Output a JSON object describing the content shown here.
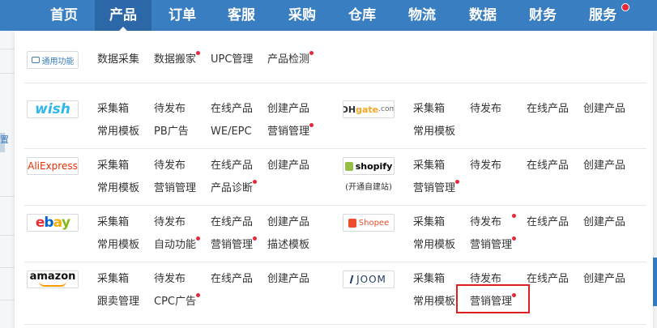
{
  "nav": {
    "items": [
      "首页",
      "产品",
      "订单",
      "客服",
      "采购",
      "仓库",
      "物流",
      "数据",
      "财务",
      "服务"
    ],
    "active": "产品"
  },
  "general": {
    "badge": "通用功能",
    "links": [
      "数据采集",
      "数据搬家",
      "UPC管理",
      "产品检测"
    ]
  },
  "platforms": {
    "wish": {
      "logo": "wish",
      "row1": [
        "采集箱",
        "待发布",
        "在线产品",
        "创建产品"
      ],
      "row2": [
        "常用模板",
        "PB广告",
        "WE/EPC",
        "营销管理"
      ]
    },
    "dhgate": {
      "logo_a": "DH",
      "logo_b": "gate",
      "logo_c": ".com",
      "row1": [
        "采集箱",
        "待发布",
        "在线产品",
        "创建产品"
      ],
      "row2": [
        "常用模板"
      ]
    },
    "aliexpress": {
      "logo": "AliExpress",
      "row1": [
        "采集箱",
        "待发布",
        "在线产品",
        "创建产品"
      ],
      "row2": [
        "常用模板",
        "营销管理",
        "产品诊断"
      ]
    },
    "shopify": {
      "logo": "shopify",
      "sub": "(开通自建站)",
      "row1": [
        "采集箱",
        "待发布",
        "在线产品",
        "创建产品"
      ],
      "row2": [
        "营销管理"
      ]
    },
    "ebay": {
      "logo_letters": [
        "e",
        "b",
        "a",
        "y"
      ],
      "row1": [
        "采集箱",
        "待发布",
        "在线产品",
        "创建产品"
      ],
      "row2": [
        "常用模板",
        "自动功能",
        "营销管理",
        "描述模板"
      ]
    },
    "shopee": {
      "logo": "Shopee",
      "row1": [
        "采集箱",
        "待发布",
        "在线产品",
        "创建产品"
      ],
      "row2": [
        "常用模板",
        "营销管理"
      ]
    },
    "amazon": {
      "logo": "amazon",
      "row1": [
        "采集箱",
        "待发布",
        "在线产品",
        "创建产品"
      ],
      "row2": [
        "跟卖管理",
        "CPC广告"
      ]
    },
    "joom": {
      "logo": "JOOM",
      "row1": [
        "采集箱",
        "待发布",
        "在线产品",
        "创建产品"
      ],
      "row2": [
        "常用模板",
        "营销管理"
      ]
    }
  },
  "background": {
    "edge_char": "置"
  },
  "colors": {
    "nav_bg": "#3a7ec2",
    "nav_active": "#2c68a8",
    "badge_dot": "#e5283a",
    "highlight": "#e02020"
  }
}
